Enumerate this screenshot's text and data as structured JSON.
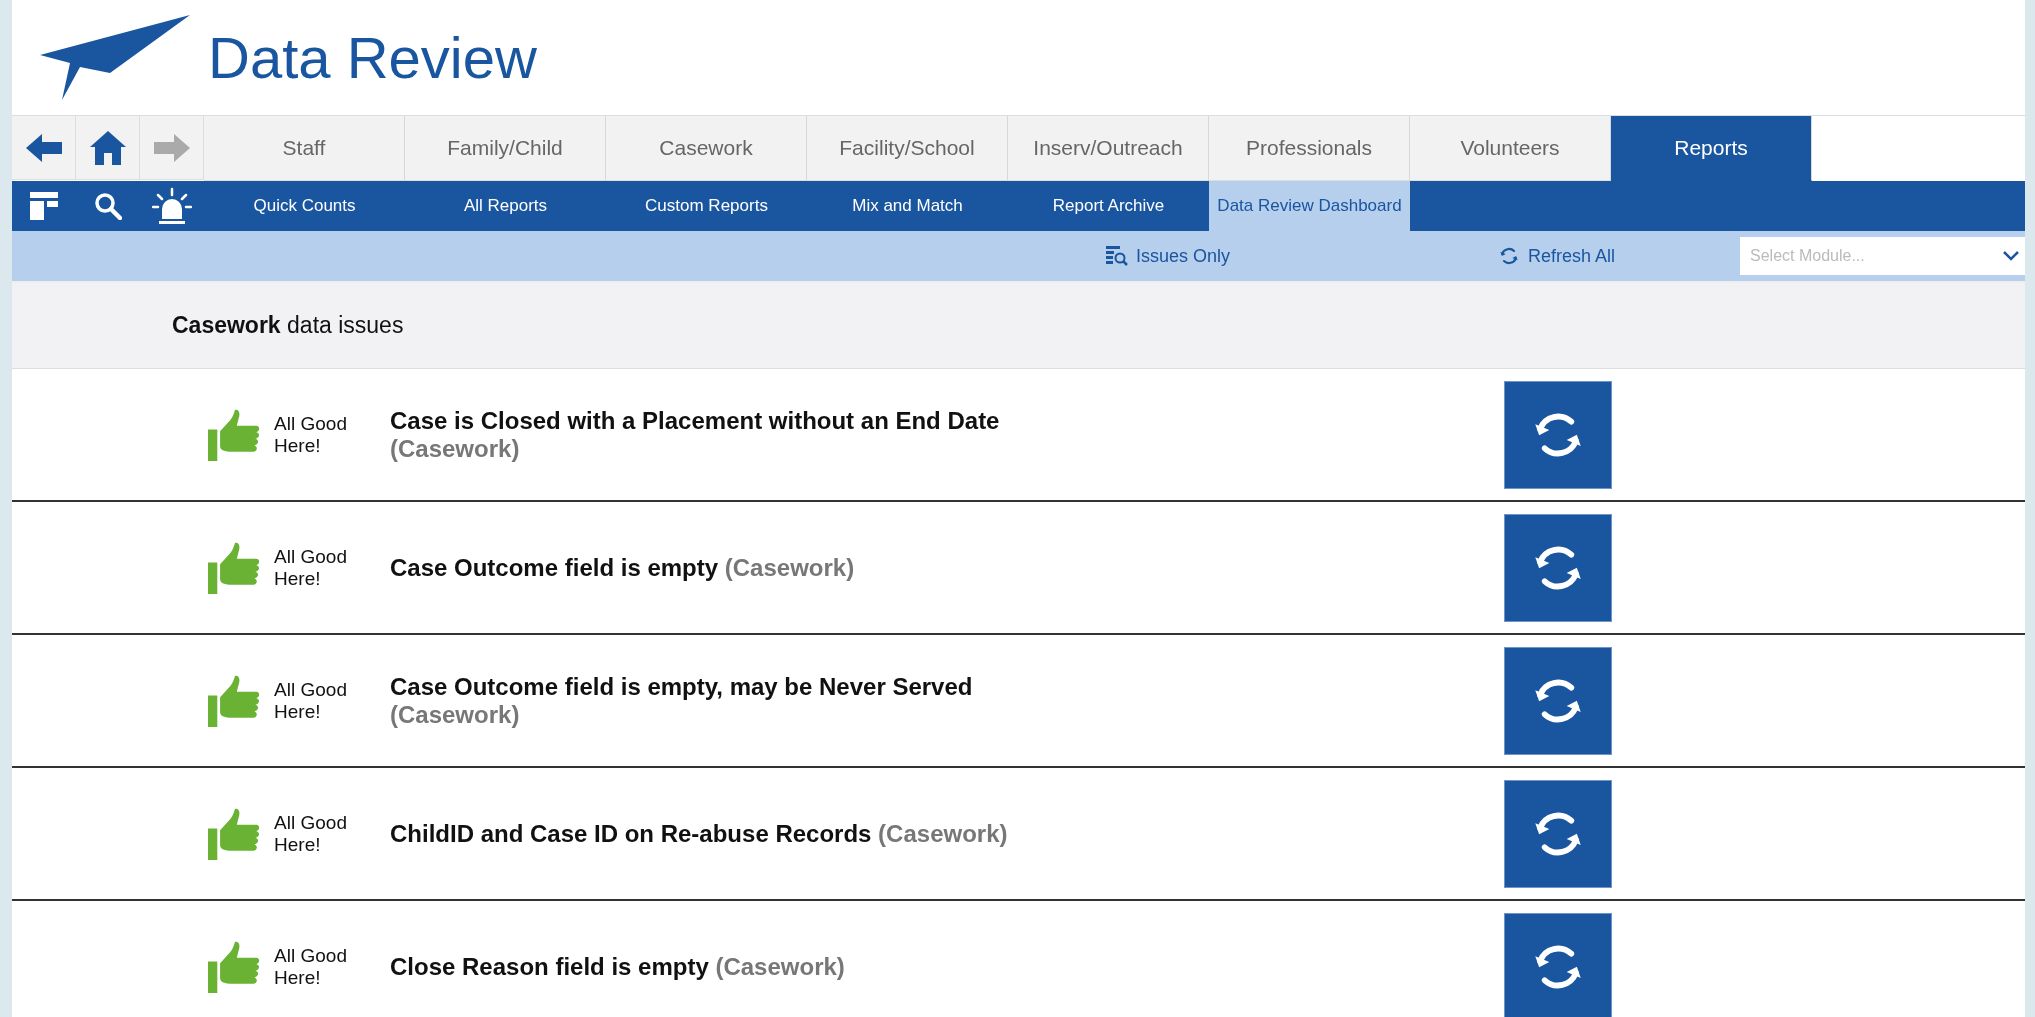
{
  "header": {
    "title": "Data Review"
  },
  "main_tabs": [
    {
      "label": "Staff",
      "selected": false
    },
    {
      "label": "Family/Child",
      "selected": false
    },
    {
      "label": "Casework",
      "selected": false
    },
    {
      "label": "Facility/School",
      "selected": false
    },
    {
      "label": "Inserv/Outreach",
      "selected": false
    },
    {
      "label": "Professionals",
      "selected": false
    },
    {
      "label": "Volunteers",
      "selected": false
    },
    {
      "label": "Reports",
      "selected": true
    }
  ],
  "sub_tabs": [
    {
      "label": "Quick Counts",
      "selected": false
    },
    {
      "label": "All Reports",
      "selected": false
    },
    {
      "label": "Custom Reports",
      "selected": false
    },
    {
      "label": "Mix and Match",
      "selected": false
    },
    {
      "label": "Report Archive",
      "selected": false
    },
    {
      "label": "Data Review Dashboard",
      "selected": true
    }
  ],
  "toolbar": {
    "issues_only": "Issues Only",
    "refresh_all": "Refresh All",
    "module_select": {
      "placeholder": "Select Module..."
    }
  },
  "section": {
    "module": "Casework",
    "title_rest": "data issues"
  },
  "issues": [
    {
      "status": "All Good Here!",
      "title": "Case is Closed with a Placement without an End Date",
      "module": "(Casework)"
    },
    {
      "status": "All Good Here!",
      "title": "Case Outcome field is empty",
      "module": "(Casework)"
    },
    {
      "status": "All Good Here!",
      "title": "Case Outcome field is empty, may be Never Served",
      "module": "(Casework)"
    },
    {
      "status": "All Good Here!",
      "title": "ChildID and Case ID on Re-abuse Records",
      "module": "(Casework)"
    },
    {
      "status": "All Good Here!",
      "title": "Close Reason field is empty",
      "module": "(Casework)"
    }
  ]
}
